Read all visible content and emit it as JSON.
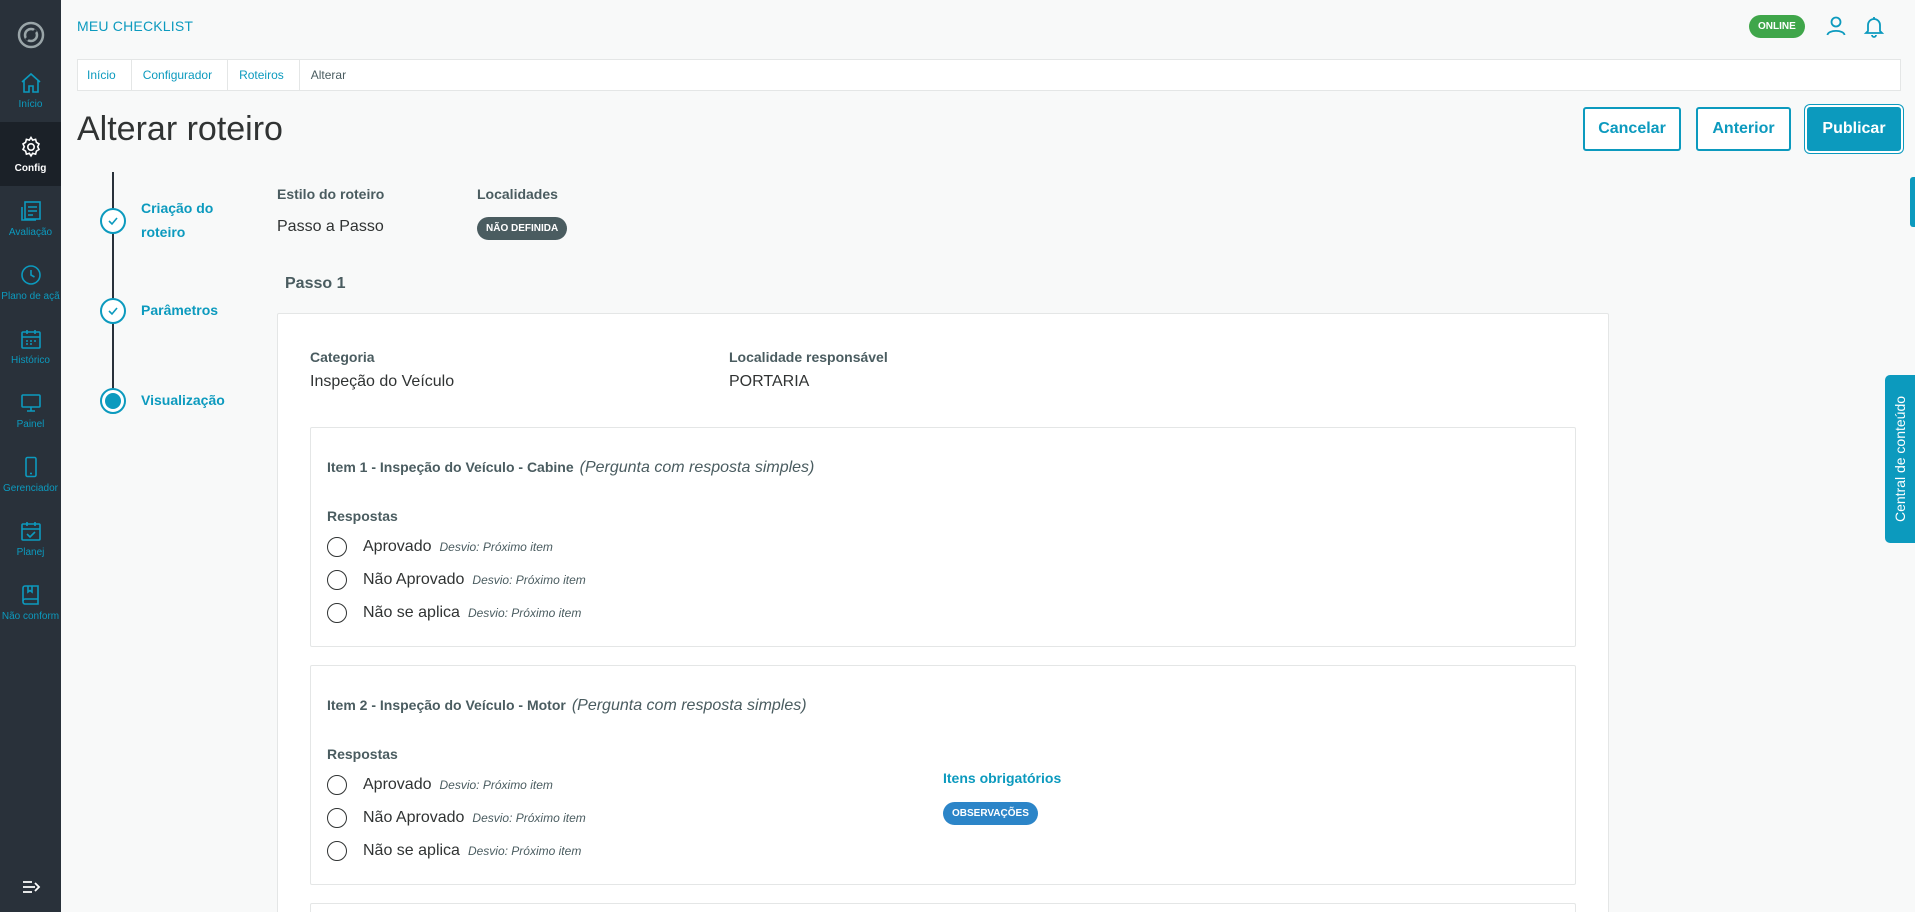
{
  "sidebar": {
    "items": [
      {
        "label": "Início",
        "icon": "home-icon"
      },
      {
        "label": "Config",
        "icon": "gear-icon"
      },
      {
        "label": "Avaliação",
        "icon": "document-list-icon"
      },
      {
        "label": "Plano de açã",
        "icon": "clock-icon"
      },
      {
        "label": "Histórico",
        "icon": "calendar-icon"
      },
      {
        "label": "Painel",
        "icon": "monitor-icon"
      },
      {
        "label": "Gerenciador",
        "icon": "mobile-icon"
      },
      {
        "label": "Planej",
        "icon": "calendar-check-icon"
      },
      {
        "label": "Não conform",
        "icon": "book-icon"
      }
    ],
    "active_index": 1
  },
  "header": {
    "app_title": "MEU CHECKLIST",
    "status": "ONLINE"
  },
  "breadcrumb": [
    "Início",
    "Configurador",
    "Roteiros",
    "Alterar"
  ],
  "page": {
    "title": "Alterar roteiro",
    "buttons": {
      "cancel": "Cancelar",
      "previous": "Anterior",
      "publish": "Publicar"
    }
  },
  "stepper": [
    {
      "label_line1": "Criação do",
      "label_line2": "roteiro",
      "state": "done"
    },
    {
      "label_line1": "Parâmetros",
      "label_line2": "",
      "state": "done"
    },
    {
      "label_line1": "Visualização",
      "label_line2": "",
      "state": "current"
    }
  ],
  "info": {
    "style_label": "Estilo do roteiro",
    "style_value": "Passo a Passo",
    "locations_label": "Localidades",
    "locations_badge": "NÃO DEFINIDA"
  },
  "step": {
    "title": "Passo 1",
    "category_label": "Categoria",
    "category_value": "Inspeção do Veículo",
    "location_label": "Localidade responsável",
    "location_value": "PORTARIA"
  },
  "items": [
    {
      "title": "Item 1 - Inspeção do Veículo - Cabine",
      "type": "(Pergunta com resposta simples)",
      "responses_label": "Respostas",
      "responses": [
        {
          "text": "Aprovado",
          "deviation": "Desvio: Próximo item"
        },
        {
          "text": "Não Aprovado",
          "deviation": "Desvio: Próximo item"
        },
        {
          "text": "Não se aplica",
          "deviation": "Desvio: Próximo item"
        }
      ]
    },
    {
      "title": "Item 2 - Inspeção do Veículo - Motor",
      "type": "(Pergunta com resposta simples)",
      "responses_label": "Respostas",
      "responses": [
        {
          "text": "Aprovado",
          "deviation": "Desvio: Próximo item"
        },
        {
          "text": "Não Aprovado",
          "deviation": "Desvio: Próximo item"
        },
        {
          "text": "Não se aplica",
          "deviation": "Desvio: Próximo item"
        }
      ],
      "required_label": "Itens obrigatórios",
      "required_badge": "OBSERVAÇÕES"
    }
  ],
  "side_tab": "Central de conteúdo",
  "colors": {
    "accent": "#0c9abe",
    "sidebar": "#29313a",
    "online": "#3fa64a",
    "badge_dark": "#4a5c60",
    "badge_blue": "#2c85c8"
  }
}
